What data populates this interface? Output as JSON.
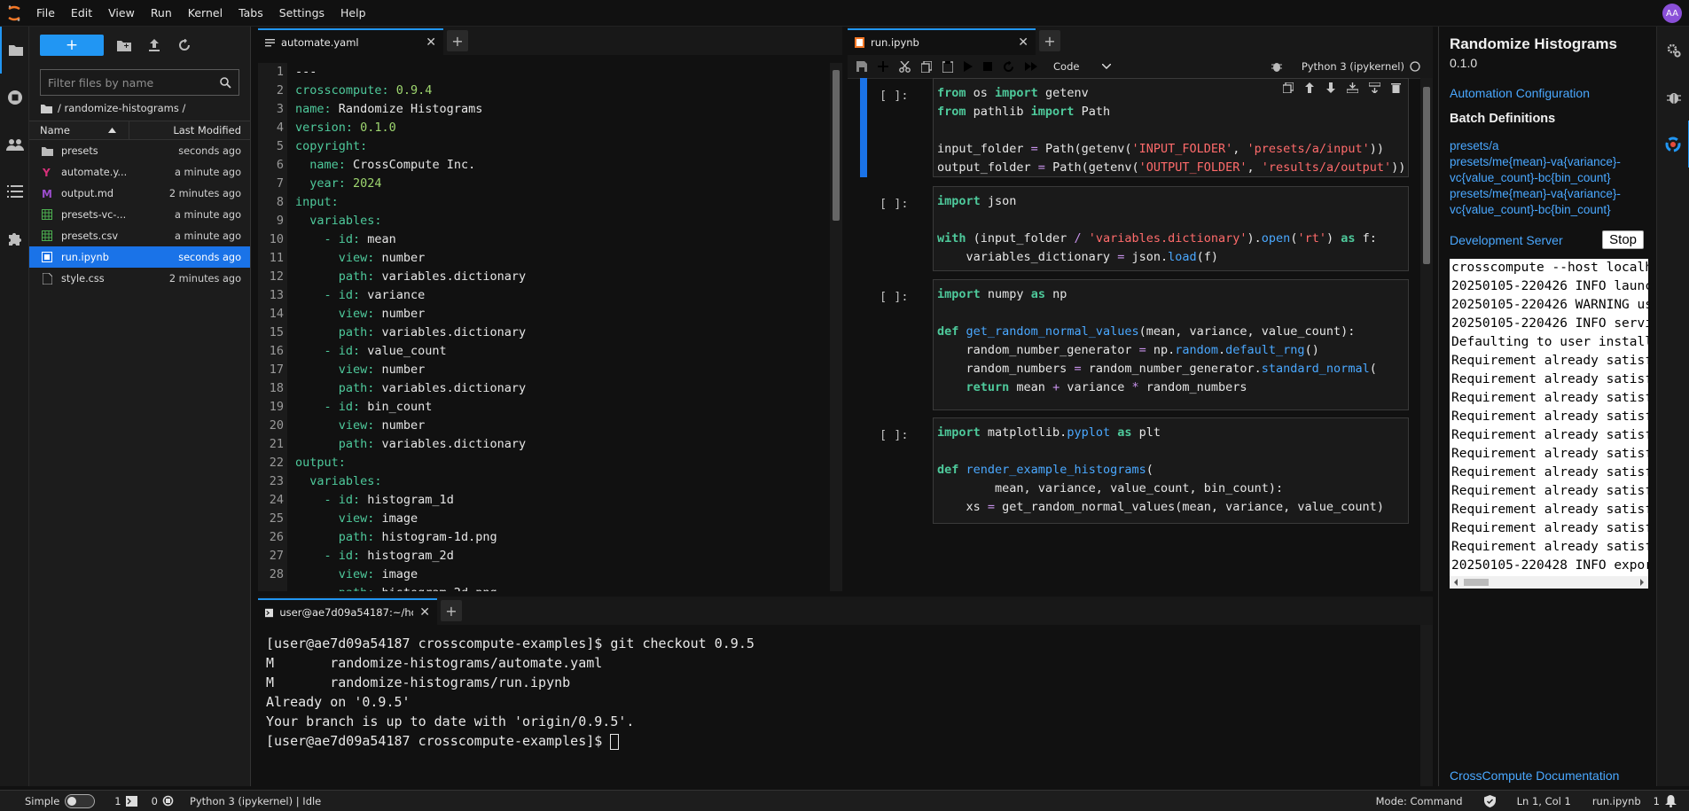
{
  "menubar": {
    "items": [
      "File",
      "Edit",
      "View",
      "Run",
      "Kernel",
      "Tabs",
      "Settings",
      "Help"
    ],
    "avatar_initials": "AA",
    "accent": "#2196f3"
  },
  "filebrowser": {
    "filter_placeholder": "Filter files by name",
    "breadcrumb": "/ randomize-histograms /",
    "col_name": "Name",
    "col_modified": "Last Modified",
    "files": [
      {
        "name": "presets",
        "modified": "seconds ago",
        "icon": "folder-icon"
      },
      {
        "name": "automate.y...",
        "modified": "a minute ago",
        "icon": "yaml-icon"
      },
      {
        "name": "output.md",
        "modified": "2 minutes ago",
        "icon": "markdown-icon"
      },
      {
        "name": "presets-vc-...",
        "modified": "a minute ago",
        "icon": "spreadsheet-icon"
      },
      {
        "name": "presets.csv",
        "modified": "a minute ago",
        "icon": "spreadsheet-icon"
      },
      {
        "name": "run.ipynb",
        "modified": "seconds ago",
        "icon": "notebook-icon",
        "selected": true
      },
      {
        "name": "style.css",
        "modified": "2 minutes ago",
        "icon": "file-icon"
      }
    ]
  },
  "editor": {
    "tab_label": "automate.yaml",
    "line_numbers": [
      "1",
      "2",
      "3",
      "4",
      "5",
      "6",
      "7",
      "8",
      "9",
      "10",
      "11",
      "12",
      "13",
      "14",
      "15",
      "16",
      "17",
      "18",
      "19",
      "20",
      "21",
      "22",
      "23",
      "24",
      "25",
      "26",
      "27",
      "28"
    ],
    "lines": [
      [
        {
          "t": "---",
          "c": "v"
        }
      ],
      [
        {
          "t": "crosscompute:",
          "c": "k"
        },
        {
          "t": " 0.9.4",
          "c": "n"
        }
      ],
      [
        {
          "t": "name:",
          "c": "k"
        },
        {
          "t": " Randomize Histograms",
          "c": "v"
        }
      ],
      [
        {
          "t": "version:",
          "c": "k"
        },
        {
          "t": " 0.1.0",
          "c": "n"
        }
      ],
      [
        {
          "t": "copyright:",
          "c": "k"
        }
      ],
      [
        {
          "t": "  name:",
          "c": "k"
        },
        {
          "t": " CrossCompute Inc.",
          "c": "v"
        }
      ],
      [
        {
          "t": "  year:",
          "c": "k"
        },
        {
          "t": " 2024",
          "c": "n"
        }
      ],
      [
        {
          "t": "input:",
          "c": "k"
        }
      ],
      [
        {
          "t": "  variables:",
          "c": "k"
        }
      ],
      [
        {
          "t": "    - id:",
          "c": "k"
        },
        {
          "t": " mean",
          "c": "v"
        }
      ],
      [
        {
          "t": "      view:",
          "c": "k"
        },
        {
          "t": " number",
          "c": "v"
        }
      ],
      [
        {
          "t": "      path:",
          "c": "k"
        },
        {
          "t": " variables.dictionary",
          "c": "v"
        }
      ],
      [
        {
          "t": "    - id:",
          "c": "k"
        },
        {
          "t": " variance",
          "c": "v"
        }
      ],
      [
        {
          "t": "      view:",
          "c": "k"
        },
        {
          "t": " number",
          "c": "v"
        }
      ],
      [
        {
          "t": "      path:",
          "c": "k"
        },
        {
          "t": " variables.dictionary",
          "c": "v"
        }
      ],
      [
        {
          "t": "    - id:",
          "c": "k"
        },
        {
          "t": " value_count",
          "c": "v"
        }
      ],
      [
        {
          "t": "      view:",
          "c": "k"
        },
        {
          "t": " number",
          "c": "v"
        }
      ],
      [
        {
          "t": "      path:",
          "c": "k"
        },
        {
          "t": " variables.dictionary",
          "c": "v"
        }
      ],
      [
        {
          "t": "    - id:",
          "c": "k"
        },
        {
          "t": " bin_count",
          "c": "v"
        }
      ],
      [
        {
          "t": "      view:",
          "c": "k"
        },
        {
          "t": " number",
          "c": "v"
        }
      ],
      [
        {
          "t": "      path:",
          "c": "k"
        },
        {
          "t": " variables.dictionary",
          "c": "v"
        }
      ],
      [
        {
          "t": "output:",
          "c": "k"
        }
      ],
      [
        {
          "t": "  variables:",
          "c": "k"
        }
      ],
      [
        {
          "t": "    - id:",
          "c": "k"
        },
        {
          "t": " histogram_1d",
          "c": "v"
        }
      ],
      [
        {
          "t": "      view:",
          "c": "k"
        },
        {
          "t": " image",
          "c": "v"
        }
      ],
      [
        {
          "t": "      path:",
          "c": "k"
        },
        {
          "t": " histogram-1d.png",
          "c": "v"
        }
      ],
      [
        {
          "t": "    - id:",
          "c": "k"
        },
        {
          "t": " histogram_2d",
          "c": "v"
        }
      ],
      [
        {
          "t": "      view:",
          "c": "k"
        },
        {
          "t": " image",
          "c": "v"
        }
      ],
      [
        {
          "t": "      path:",
          "c": "k"
        },
        {
          "t": " histogram-2d.png",
          "c": "v"
        }
      ]
    ]
  },
  "notebook": {
    "tab_label": "run.ipynb",
    "cell_type": "Code",
    "kernel": "Python 3 (ipykernel)",
    "cells": [
      {
        "prompt": "[ ]:",
        "active": true,
        "lines": [
          [
            {
              "t": "from",
              "c": "py-kw"
            },
            {
              "t": " os ",
              "c": ""
            },
            {
              "t": "import",
              "c": "py-kw"
            },
            {
              "t": " getenv",
              "c": ""
            }
          ],
          [
            {
              "t": "from",
              "c": "py-kw"
            },
            {
              "t": " pathlib ",
              "c": ""
            },
            {
              "t": "import",
              "c": "py-kw"
            },
            {
              "t": " Path",
              "c": ""
            }
          ],
          [
            {
              "t": "",
              "c": ""
            }
          ],
          [
            {
              "t": "input_folder ",
              "c": ""
            },
            {
              "t": "=",
              "c": "py-op"
            },
            {
              "t": " Path(getenv(",
              "c": ""
            },
            {
              "t": "'INPUT_FOLDER'",
              "c": "py-str"
            },
            {
              "t": ", ",
              "c": ""
            },
            {
              "t": "'presets/a/input'",
              "c": "py-str"
            },
            {
              "t": "))",
              "c": ""
            }
          ],
          [
            {
              "t": "output_folder ",
              "c": ""
            },
            {
              "t": "=",
              "c": "py-op"
            },
            {
              "t": " Path(getenv(",
              "c": ""
            },
            {
              "t": "'OUTPUT_FOLDER'",
              "c": "py-str"
            },
            {
              "t": ", ",
              "c": ""
            },
            {
              "t": "'results/a/output'",
              "c": "py-str"
            },
            {
              "t": "))",
              "c": ""
            }
          ],
          [
            {
              "t": "output_folder.",
              "c": ""
            },
            {
              "t": "mkdir",
              "c": "py-fn"
            },
            {
              "t": "(parents",
              "c": ""
            },
            {
              "t": "=",
              "c": "py-op"
            },
            {
              "t": "True",
              "c": "py-true"
            },
            {
              "t": ", exist_ok",
              "c": ""
            },
            {
              "t": "=",
              "c": "py-op"
            },
            {
              "t": "True",
              "c": "py-true"
            },
            {
              "t": ")",
              "c": ""
            }
          ]
        ]
      },
      {
        "prompt": "[ ]:",
        "lines": [
          [
            {
              "t": "import",
              "c": "py-kw"
            },
            {
              "t": " json",
              "c": ""
            }
          ],
          [
            {
              "t": "",
              "c": ""
            }
          ],
          [
            {
              "t": "with",
              "c": "py-kw"
            },
            {
              "t": " (input_folder ",
              "c": ""
            },
            {
              "t": "/",
              "c": "py-op"
            },
            {
              "t": " ",
              "c": ""
            },
            {
              "t": "'variables.dictionary'",
              "c": "py-str"
            },
            {
              "t": ").",
              "c": ""
            },
            {
              "t": "open",
              "c": "py-fn"
            },
            {
              "t": "(",
              "c": ""
            },
            {
              "t": "'rt'",
              "c": "py-str"
            },
            {
              "t": ") ",
              "c": ""
            },
            {
              "t": "as",
              "c": "py-kw"
            },
            {
              "t": " f:",
              "c": ""
            }
          ],
          [
            {
              "t": "    variables_dictionary ",
              "c": ""
            },
            {
              "t": "=",
              "c": "py-op"
            },
            {
              "t": " json.",
              "c": ""
            },
            {
              "t": "load",
              "c": "py-fn"
            },
            {
              "t": "(f)",
              "c": ""
            }
          ],
          [
            {
              "t": "variables_dictionary",
              "c": ""
            }
          ]
        ]
      },
      {
        "prompt": "[ ]:",
        "lines": [
          [
            {
              "t": "import",
              "c": "py-kw"
            },
            {
              "t": " numpy ",
              "c": ""
            },
            {
              "t": "as",
              "c": "py-kw"
            },
            {
              "t": " np",
              "c": ""
            }
          ],
          [
            {
              "t": "",
              "c": ""
            }
          ],
          [
            {
              "t": "def",
              "c": "py-kw"
            },
            {
              "t": " ",
              "c": ""
            },
            {
              "t": "get_random_normal_values",
              "c": "py-fn"
            },
            {
              "t": "(mean, variance, value_count):",
              "c": ""
            }
          ],
          [
            {
              "t": "    random_number_generator ",
              "c": ""
            },
            {
              "t": "=",
              "c": "py-op"
            },
            {
              "t": " np.",
              "c": ""
            },
            {
              "t": "random",
              "c": "py-fn"
            },
            {
              "t": ".",
              "c": ""
            },
            {
              "t": "default_rng",
              "c": "py-fn"
            },
            {
              "t": "()",
              "c": ""
            }
          ],
          [
            {
              "t": "    random_numbers ",
              "c": ""
            },
            {
              "t": "=",
              "c": "py-op"
            },
            {
              "t": " random_number_generator.",
              "c": ""
            },
            {
              "t": "standard_normal",
              "c": "py-fn"
            },
            {
              "t": "(",
              "c": ""
            }
          ],
          [
            {
              "t": "    ",
              "c": ""
            },
            {
              "t": "return",
              "c": "py-kw"
            },
            {
              "t": " mean ",
              "c": ""
            },
            {
              "t": "+",
              "c": "py-op"
            },
            {
              "t": " variance ",
              "c": ""
            },
            {
              "t": "*",
              "c": "py-op"
            },
            {
              "t": " random_numbers",
              "c": ""
            }
          ],
          [
            {
              "t": "",
              "c": ""
            }
          ],
          [
            {
              "t": "get_random_normal_values(",
              "c": ""
            },
            {
              "t": "0",
              "c": "py-num"
            },
            {
              "t": ", ",
              "c": ""
            },
            {
              "t": "10",
              "c": "py-num"
            },
            {
              "t": ", ",
              "c": ""
            },
            {
              "t": "3",
              "c": "py-num"
            },
            {
              "t": ")",
              "c": ""
            }
          ]
        ]
      },
      {
        "prompt": "[ ]:",
        "lines": [
          [
            {
              "t": "import",
              "c": "py-kw"
            },
            {
              "t": " matplotlib.",
              "c": ""
            },
            {
              "t": "pyplot",
              "c": "py-fn"
            },
            {
              "t": " ",
              "c": ""
            },
            {
              "t": "as",
              "c": "py-kw"
            },
            {
              "t": " plt",
              "c": ""
            }
          ],
          [
            {
              "t": "",
              "c": ""
            }
          ],
          [
            {
              "t": "def",
              "c": "py-kw"
            },
            {
              "t": " ",
              "c": ""
            },
            {
              "t": "render_example_histograms",
              "c": "py-fn"
            },
            {
              "t": "(",
              "c": ""
            }
          ],
          [
            {
              "t": "        mean, variance, value_count, bin_count):",
              "c": ""
            }
          ],
          [
            {
              "t": "    xs ",
              "c": ""
            },
            {
              "t": "=",
              "c": "py-op"
            },
            {
              "t": " get_random_normal_values(mean, variance, value_count)",
              "c": ""
            }
          ]
        ]
      }
    ]
  },
  "terminal": {
    "tab_label": "user@ae7d09a54187:~/home/",
    "lines": [
      "[user@ae7d09a54187 crosscompute-examples]$ git checkout 0.9.5",
      "M       randomize-histograms/automate.yaml",
      "M       randomize-histograms/run.ipynb",
      "Already on '0.9.5'",
      "Your branch is up to date with 'origin/0.9.5'."
    ],
    "prompt": "[user@ae7d09a54187 crosscompute-examples]$ "
  },
  "preview": {
    "title": "Randomize Histograms",
    "version": "0.1.0",
    "automation_link": "Automation Configuration",
    "batch_heading": "Batch Definitions",
    "batch_links": [
      "presets/a",
      "presets/me{mean}-va{variance}-vc{value_count}-bc{bin_count}",
      "presets/me{mean}-va{variance}-vc{value_count}-bc{bin_count}"
    ],
    "dev_server_link": "Development Server",
    "stop_label": "Stop",
    "log_lines": [
      "crosscompute --host localhost",
      "20250105-220426 INFO launching",
      "20250105-220426 WARNING using",
      "20250105-220426 INFO serving",
      "Defaulting to user installation",
      "Requirement already satisfied",
      "Requirement already satisfied",
      "Requirement already satisfied",
      "Requirement already satisfied",
      "Requirement already satisfied",
      "Requirement already satisfied",
      "Requirement already satisfied",
      "Requirement already satisfied",
      "Requirement already satisfied",
      "Requirement already satisfied",
      "Requirement already satisfied",
      "20250105-220428 INFO exporting"
    ],
    "doc_link": "CrossCompute Documentation"
  },
  "statusbar": {
    "simple_label": "Simple",
    "terminals_count": "1",
    "kernels_count": "0",
    "kernel_status": "Python 3 (ipykernel) | Idle",
    "mode": "Mode: Command",
    "cursor_pos": "Ln 1, Col 1",
    "file_name": "run.ipynb",
    "notifications_count": "1"
  }
}
